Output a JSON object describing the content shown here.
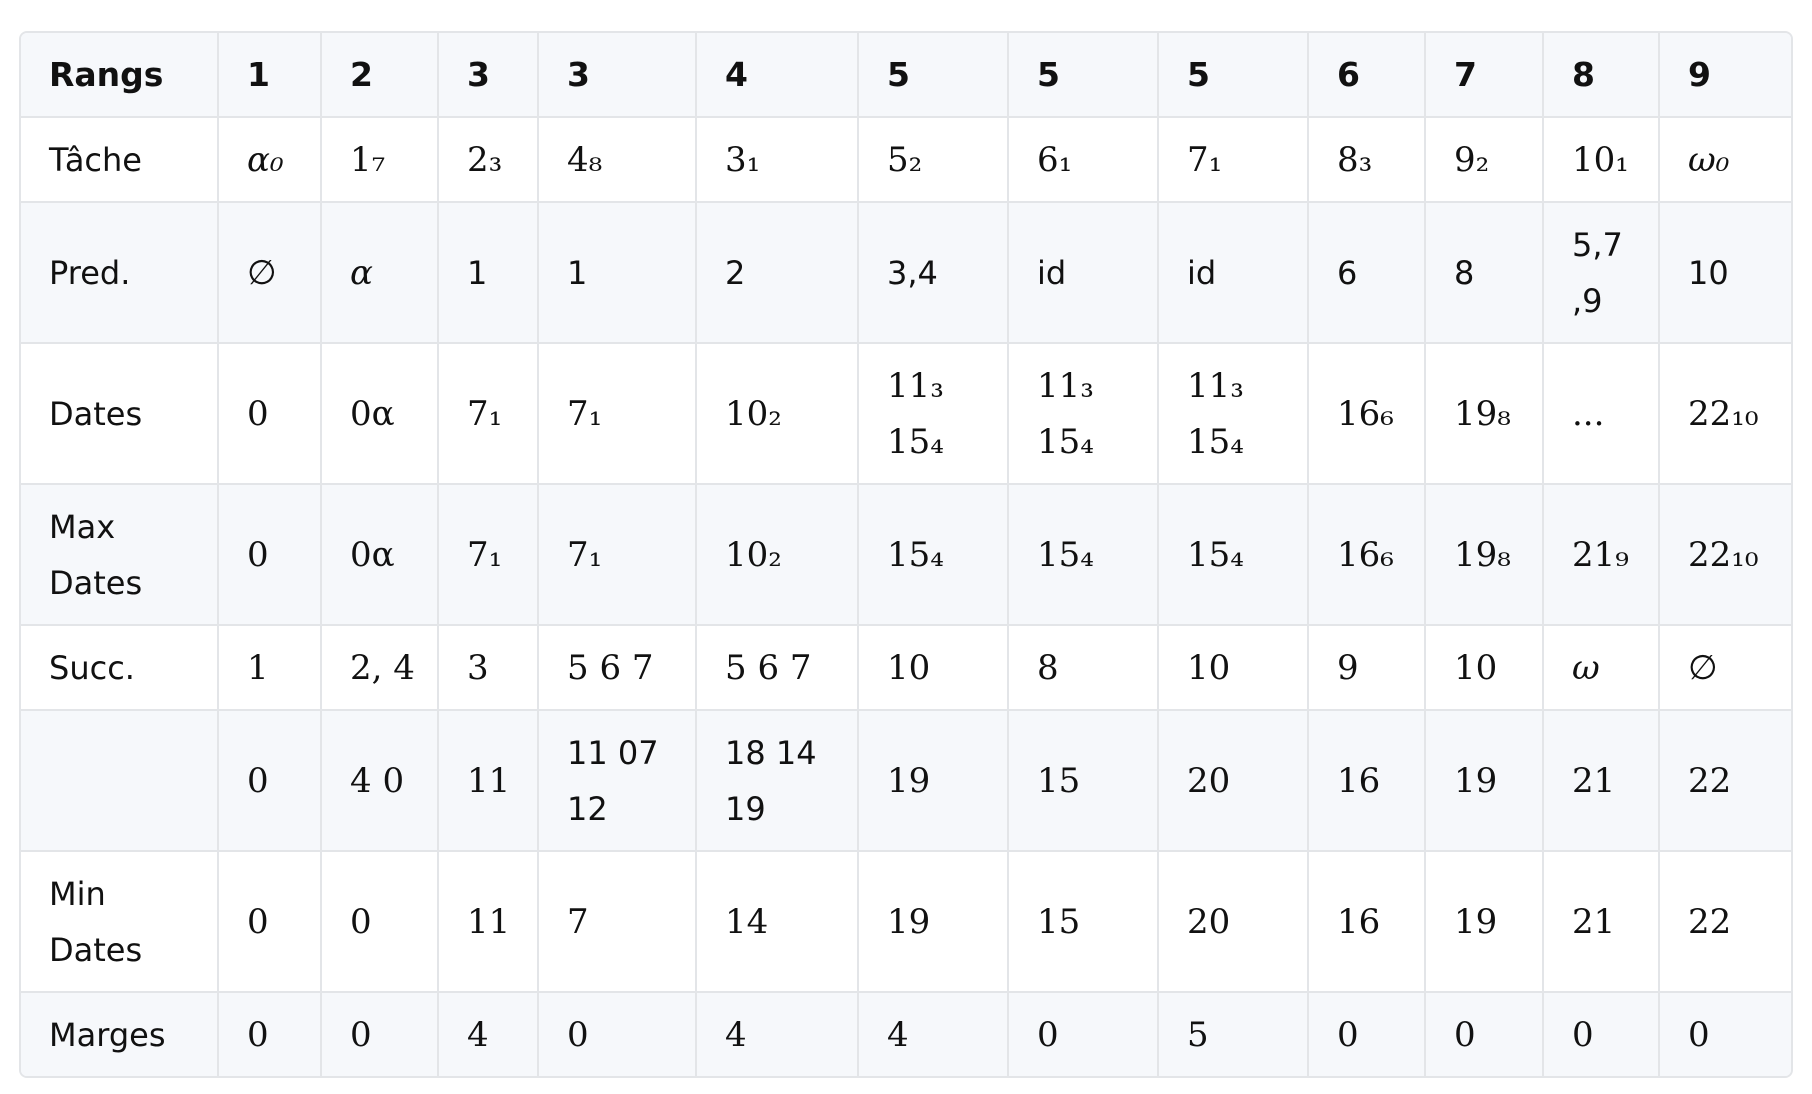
{
  "table": {
    "header": [
      "Rangs",
      "1",
      "2",
      "3",
      "3",
      "4",
      "5",
      "5",
      "5",
      "6",
      "7",
      "8",
      "9"
    ],
    "rows": [
      {
        "label": "Tâche",
        "cells": [
          "α₀",
          "1₇",
          "2₃",
          "4₈",
          "3₁",
          "5₂",
          "6₁",
          "7₁",
          "8₃",
          "9₂",
          "10₁",
          "ω₀"
        ]
      },
      {
        "label": "Pred.",
        "cells": [
          "∅",
          "α",
          "1",
          "1",
          "2",
          "3,4",
          "id",
          "id",
          "6",
          "8",
          "5,7\n,9",
          "10"
        ]
      },
      {
        "label": "Dates",
        "cells": [
          "0",
          "0α",
          "7₁",
          "7₁",
          "10₂",
          "11₃\n15₄",
          "11₃\n15₄",
          "11₃\n15₄",
          "16₆",
          "19₈",
          "...",
          "22₁₀"
        ]
      },
      {
        "label": "Max\nDates",
        "cells": [
          "0",
          "0α",
          "7₁",
          "7₁",
          "10₂",
          "15₄",
          "15₄",
          "15₄",
          "16₆",
          "19₈",
          "21₉",
          "22₁₀"
        ]
      },
      {
        "label": "Succ.",
        "cells": [
          "1",
          "2, 4",
          "3",
          "5 6 7",
          "5 6 7",
          "10",
          "8",
          "10",
          "9",
          "10",
          "ω",
          "∅"
        ]
      },
      {
        "label": "",
        "cells": [
          "0",
          "4 0",
          "11",
          "11 07\n12",
          "18 14\n19",
          "19",
          "15",
          "20",
          "16",
          "19",
          "21",
          "22"
        ]
      },
      {
        "label": "Min\nDates",
        "cells": [
          "0",
          "0",
          "11",
          "7",
          "14",
          "19",
          "15",
          "20",
          "16",
          "19",
          "21",
          "22"
        ]
      },
      {
        "label": "Marges",
        "cells": [
          "0",
          "0",
          "4",
          "0",
          "4",
          "4",
          "0",
          "5",
          "0",
          "0",
          "0",
          "0"
        ]
      }
    ]
  }
}
